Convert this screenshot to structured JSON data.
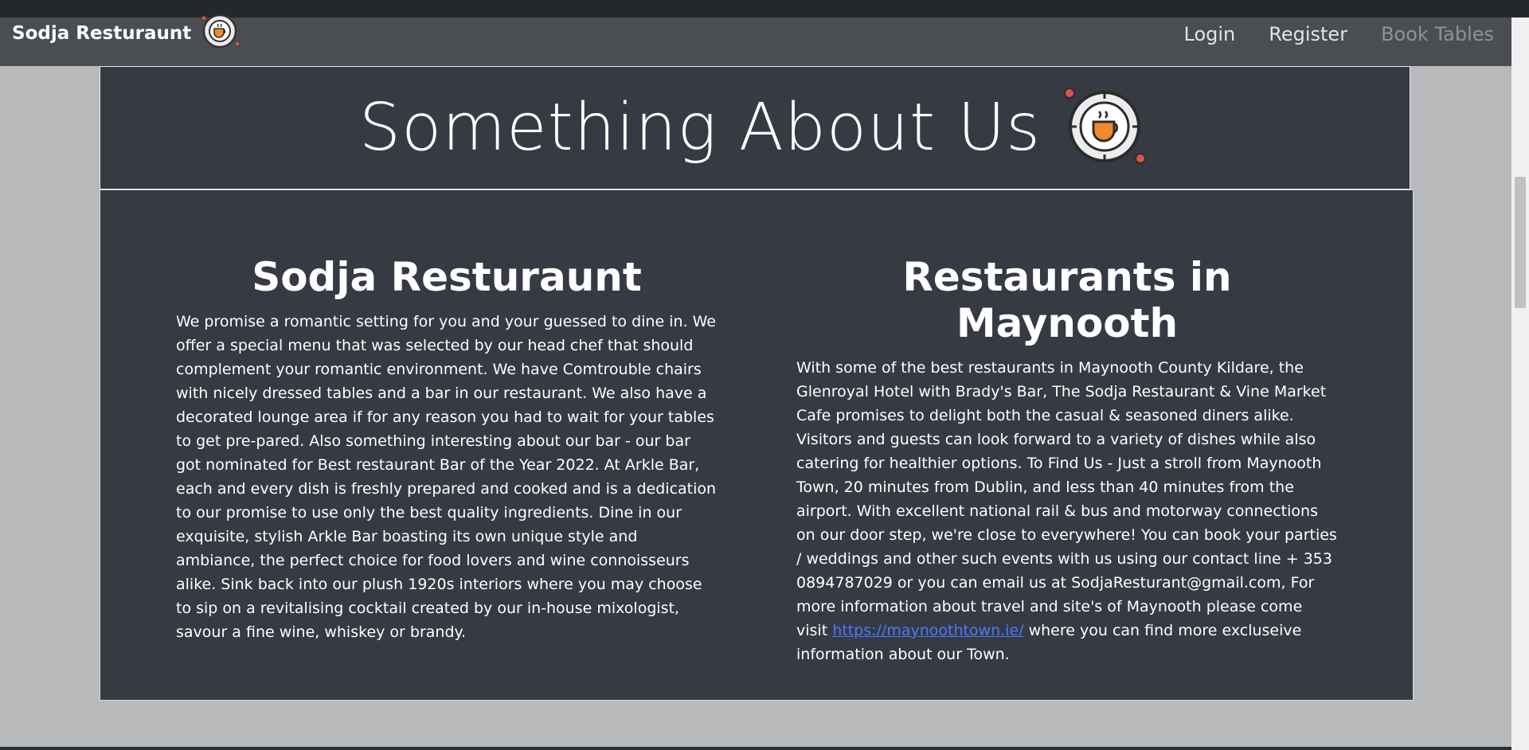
{
  "navbar": {
    "brand": "Sodja Resturaunt",
    "brand_icon": "coffee-plate-icon",
    "links": [
      {
        "label": "Login"
      },
      {
        "label": "Register"
      },
      {
        "label": "Book Tables"
      }
    ]
  },
  "header": {
    "title": "Something About Us",
    "icon": "coffee-plate-icon"
  },
  "left": {
    "heading": "Sodja Resturaunt",
    "text": "We promise a romantic setting for you and your guessed to dine in. We offer a special menu that was selected by our head chef that should complement your romantic environment. We have Comtrouble chairs with nicely dressed tables and a bar in our restaurant. We also have a decorated lounge area if for any reason you had to wait for your tables to get pre-pared. Also something interesting about our bar - our bar got nominated for Best restaurant Bar of the Year 2022. At Arkle Bar, each and every dish is freshly prepared and cooked and is a dedication to our promise to use only the best quality ingredients. Dine in our exquisite, stylish Arkle Bar boasting its own unique style and ambiance, the perfect choice for food lovers and wine connoisseurs alike. Sink back into our plush 1920s interiors where you may choose to sip on a revitalising cocktail created by our in-house mixologist, savour a fine wine, whiskey or brandy."
  },
  "right": {
    "heading": "Restaurants in Maynooth",
    "text_before": "With some of the best restaurants in Maynooth County Kildare, the Glenroyal Hotel with Brady's Bar, The Sodja Restaurant & Vine Market Cafe promises to delight both the casual & seasoned diners alike. Visitors and guests can look forward to a variety of dishes while also catering for healthier options. To Find Us - Just a stroll from Maynooth Town, 20 minutes from Dublin, and less than 40 minutes from the airport. With excellent national rail & bus and motorway connections on our door step, we're close to everywhere! You can book your parties / weddings and other such events with us using our contact line + 353 0894787029 or you can email us at SodjaResturant@gmail.com, For more information about travel and site's of Maynooth please come visit ",
    "link_text": "https://maynoothtown.ie/",
    "text_after": " where you can find more excluseive information about our Town."
  },
  "colors": {
    "navbar": "#4a4d51",
    "card": "#363a42",
    "page_bg": "#b8b9bb",
    "link": "#4a78ff"
  }
}
